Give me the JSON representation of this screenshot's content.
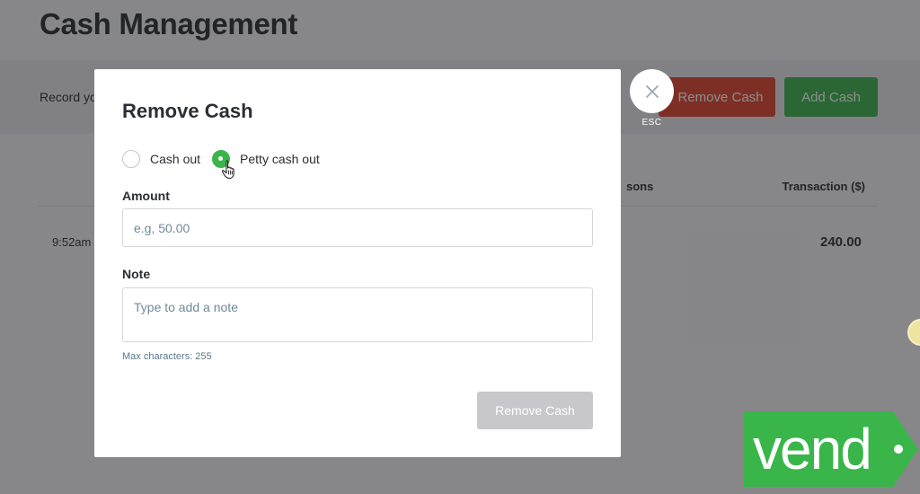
{
  "page": {
    "title": "Cash Management",
    "toolbar_description": "Record yo",
    "remove_cash_label": "Remove Cash",
    "add_cash_label": "Add Cash"
  },
  "table": {
    "headers": {
      "reasons": "sons",
      "transaction": "Transaction ($)"
    },
    "rows": [
      {
        "time": "9:52am",
        "amount": "240.00"
      }
    ]
  },
  "close": {
    "label": "ESC",
    "icon": "close-icon"
  },
  "modal": {
    "title": "Remove Cash",
    "options": [
      {
        "label": "Cash out",
        "checked": false
      },
      {
        "label": "Petty cash out",
        "checked": true
      }
    ],
    "amount": {
      "label": "Amount",
      "placeholder": "e.g, 50.00",
      "value": ""
    },
    "note": {
      "label": "Note",
      "placeholder": "Type to add a note",
      "value": "",
      "hint": "Max characters: 255"
    },
    "submit_label": "Remove Cash"
  },
  "brand": {
    "logo_text": "vend",
    "logo_color": "#3ab54a"
  },
  "colors": {
    "accent_green": "#3ab54a",
    "danger_red": "#e0452f",
    "disabled_gray": "#c8c8cc"
  }
}
